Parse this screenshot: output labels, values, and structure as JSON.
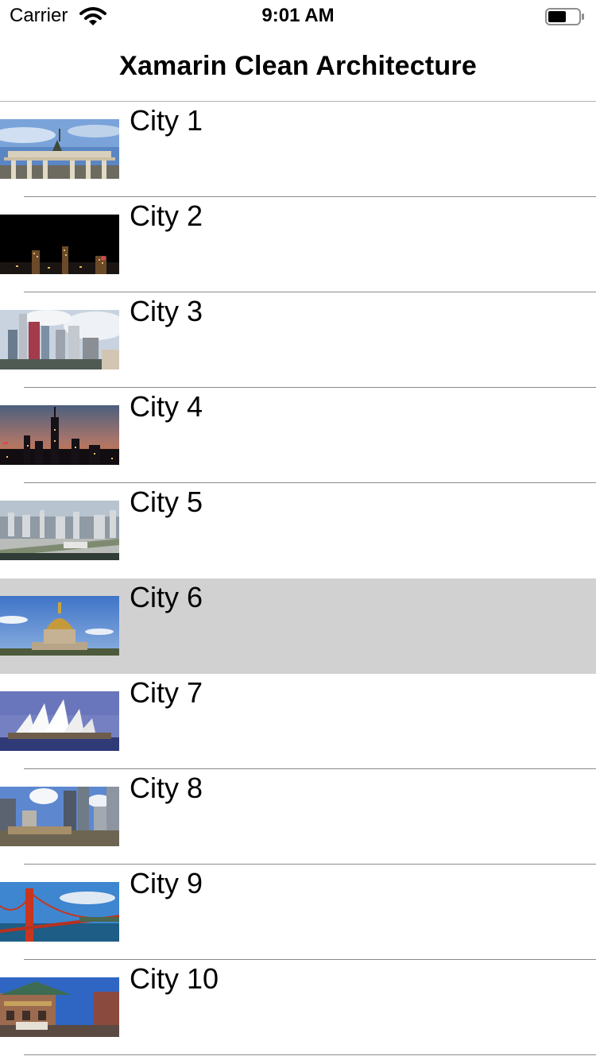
{
  "status_bar": {
    "carrier": "Carrier",
    "time": "9:01 AM",
    "battery_level": 0.6
  },
  "nav": {
    "title": "Xamarin Clean Architecture"
  },
  "cities": [
    {
      "name": "City 1",
      "thumb": "brandenburg-gate-photo"
    },
    {
      "name": "City 2",
      "thumb": "night-skyline-photo"
    },
    {
      "name": "City 3",
      "thumb": "las-vegas-skyline-photo"
    },
    {
      "name": "City 4",
      "thumb": "empire-state-sunset-photo"
    },
    {
      "name": "City 5",
      "thumb": "tokyo-cityscape-photo"
    },
    {
      "name": "City 6",
      "thumb": "dome-invalides-photo",
      "selected": true
    },
    {
      "name": "City 7",
      "thumb": "sydney-opera-house-photo"
    },
    {
      "name": "City 8",
      "thumb": "city-skyscrapers-photo"
    },
    {
      "name": "City 9",
      "thumb": "golden-gate-bridge-photo"
    },
    {
      "name": "City 10",
      "thumb": "chinatown-street-photo"
    }
  ]
}
